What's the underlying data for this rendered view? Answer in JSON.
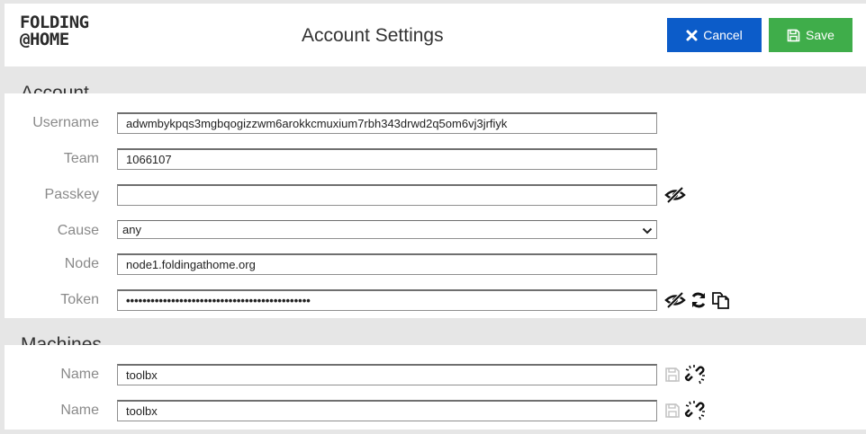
{
  "header": {
    "logo_line1": "FOLDING",
    "logo_line2": "@HOME",
    "title": "Account Settings",
    "cancel_label": "Cancel",
    "save_label": "Save"
  },
  "colors": {
    "cancel": "#0c5cc9",
    "save": "#3fad4a",
    "background": "#e6e6e6"
  },
  "account": {
    "section_title": "Account",
    "username_label": "Username",
    "username_value": "adwmbykpqs3mgbqogizzwm6arokkcmuxium7rbh343drwd2q5om6vj3jrfiyk",
    "team_label": "Team",
    "team_value": "1066107",
    "passkey_label": "Passkey",
    "passkey_value": "",
    "cause_label": "Cause",
    "cause_value": "any",
    "node_label": "Node",
    "node_value": "node1.foldingathome.org",
    "token_label": "Token",
    "token_value": "•••••••••••••••••••••••••••••••••••••••••••••"
  },
  "machines": {
    "section_title": "Machines",
    "items": [
      {
        "label": "Name",
        "value": "toolbx"
      },
      {
        "label": "Name",
        "value": "toolbx"
      }
    ]
  }
}
